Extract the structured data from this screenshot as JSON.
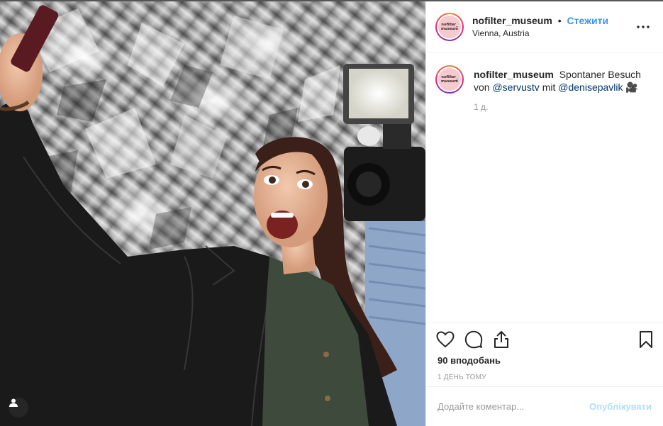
{
  "post": {
    "image_alt": "Selfie in a silver foil room with a camera operator",
    "overlay_icon": "user-tag-icon"
  },
  "header": {
    "username": "nofilter_museum",
    "separator": "•",
    "follow_label": "Стежити",
    "location": "Vienna, Austria",
    "avatar_text_line1": "nofilter_",
    "avatar_text_line2": "museum",
    "more_icon": "more-options-icon"
  },
  "caption": {
    "username": "nofilter_museum",
    "text_part1": "Spontaner Besuch von",
    "mention1": "@servustv",
    "text_part2": "mit",
    "mention2": "@denisepavlik",
    "emoji": "🎥",
    "time_ago": "1 д."
  },
  "actions": {
    "like_icon": "heart-icon",
    "comment_icon": "comment-icon",
    "share_icon": "share-icon",
    "save_icon": "bookmark-icon"
  },
  "stats": {
    "likes": "90 вподобань",
    "date": "1 день тому"
  },
  "comment_form": {
    "placeholder": "Додайте коментар...",
    "post_label": "Опублікувати"
  },
  "colors": {
    "accent": "#3897f0",
    "post_disabled": "#b3dbff",
    "muted": "#999999"
  }
}
